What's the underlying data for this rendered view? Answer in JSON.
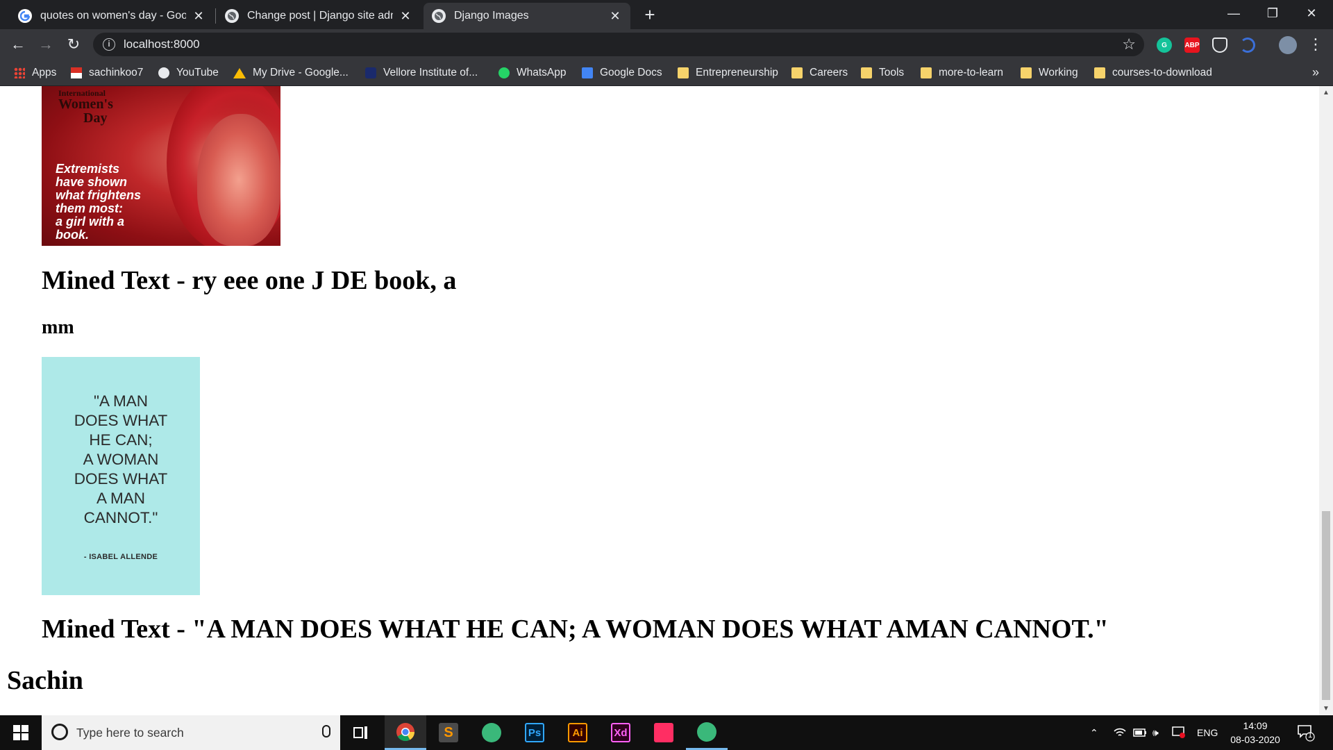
{
  "browser": {
    "tabs": [
      {
        "title": "quotes on women's day - Google",
        "favicon": "google-g-icon",
        "active": false
      },
      {
        "title": "Change post | Django site admin",
        "favicon": "globe-icon",
        "active": false
      },
      {
        "title": "Django Images",
        "favicon": "globe-icon",
        "active": true
      }
    ],
    "new_tab": "+",
    "address": "localhost:8000"
  },
  "bookmarks": [
    {
      "label": "Apps",
      "icon": "apps-grid-icon"
    },
    {
      "label": "sachinkoo7",
      "icon": "gmail-icon"
    },
    {
      "label": "YouTube",
      "icon": "globe-icon"
    },
    {
      "label": "My Drive - Google...",
      "icon": "drive-icon"
    },
    {
      "label": "Vellore Institute of...",
      "icon": "vit-icon"
    },
    {
      "label": "WhatsApp",
      "icon": "whatsapp-icon"
    },
    {
      "label": "Google Docs",
      "icon": "docs-icon"
    },
    {
      "label": "Entrepreneurship",
      "icon": "folder-icon"
    },
    {
      "label": "Careers",
      "icon": "folder-icon"
    },
    {
      "label": "Tools",
      "icon": "folder-icon"
    },
    {
      "label": "more-to-learn",
      "icon": "folder-icon"
    },
    {
      "label": "Working",
      "icon": "folder-icon"
    },
    {
      "label": "courses-to-download",
      "icon": "folder-icon"
    }
  ],
  "bookmarks_more": "»",
  "page": {
    "poster1": {
      "title_small": "International",
      "title_big_1": "Women's",
      "title_big_2": "Day",
      "quote_lines": [
        "Extremists",
        "have shown",
        "what frightens",
        "them most:",
        "a girl with a",
        "book."
      ]
    },
    "mined_text_1": "Mined Text - ry eee one J DE book, a",
    "mined_text_1b": "mm",
    "poster2": {
      "quote_lines": [
        "\"A MAN",
        "DOES WHAT",
        "HE CAN;",
        "A WOMAN",
        "DOES WHAT",
        "A MAN",
        "CANNOT.\""
      ],
      "attribution": "- ISABEL ALLENDE"
    },
    "mined_text_2": "Mined Text - \"A MAN DOES WHAT HE CAN; A WOMAN DOES WHAT AMAN CANNOT.\"",
    "author": "Sachin"
  },
  "taskbar": {
    "search_placeholder": "Type here to search",
    "apps": [
      "Chrome",
      "Sublime Text",
      "App",
      "Ps",
      "Ai",
      "Xd",
      "App",
      "App"
    ],
    "language": "ENG",
    "time": "14:09",
    "date": "08-03-2020",
    "notification_count": "1"
  },
  "colors": {
    "titlebar": "#202124",
    "toolbar": "#35363a",
    "taskbar": "#101010",
    "poster2_bg": "#aee9e8"
  }
}
